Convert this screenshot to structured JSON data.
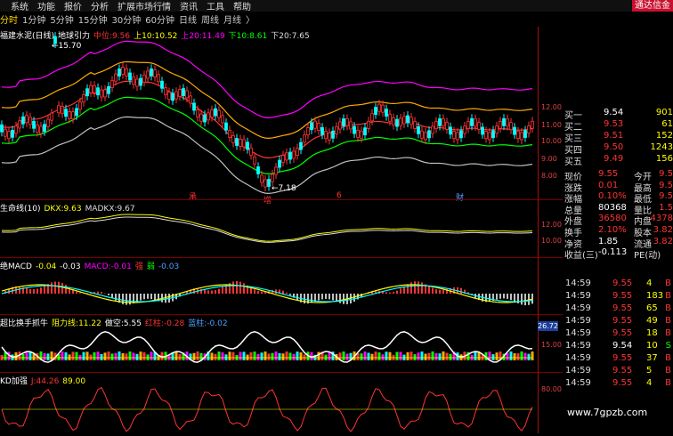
{
  "menu": {
    "items": [
      "系统",
      "功能",
      "报价",
      "分析",
      "扩展市场行情",
      "资讯",
      "工具",
      "帮助"
    ],
    "brand": "通达信金"
  },
  "periods": {
    "items": [
      "分时",
      "1分钟",
      "5分钟",
      "15分钟",
      "30分钟",
      "60分钟",
      "日线",
      "周线",
      "月线"
    ],
    "more": "〉"
  },
  "main_panel": {
    "stock": "福建水泥(日线)",
    "indicator": "地球引力",
    "mid_label": "中位:",
    "mid_value": "9.56",
    "up10_label": "上10:",
    "up10_value": "10.52",
    "up20_label": "上20:",
    "up20_value": "11.49",
    "down10_label": "下10:",
    "down10_value": "8.61",
    "down20_label": "下20:",
    "down20_value": "7.65",
    "high_mark": "15.70",
    "low_mark": "7.18",
    "event_markers": [
      "承",
      "增",
      "6",
      "财"
    ]
  },
  "panel2": {
    "name": "生命线(10)",
    "dkx_label": "DKX:",
    "dkx_value": "9.63",
    "madkx_label": "MADKX:",
    "madkx_value": "9.67"
  },
  "panel3": {
    "name": "绝MACD",
    "v1": "-0.04",
    "v2": "-0.03",
    "macd_label": "MACD:",
    "macd_value": "-0.01",
    "tag1": "强",
    "tag2": "弱",
    "v3": "-0.03"
  },
  "panel4": {
    "name": "超比换手抓牛",
    "force_label": "阻力线:",
    "force_value": "11.22",
    "short_label": "做空:",
    "short_value": "5.55",
    "red_label": "红柱:",
    "red_value": "-0.28",
    "blue_label": "蓝柱:",
    "blue_value": "-0.02",
    "box_value": "26.72"
  },
  "panel5": {
    "name": "KD加强",
    "j_label": "J:",
    "j_value": "44.26",
    "v2": "89.00"
  },
  "axis_ticks": {
    "main": [
      "12.00",
      "11.00",
      "10.00",
      "9.00",
      "8.00"
    ],
    "p2": [
      "12.00",
      "10.00"
    ],
    "p4": [
      "15.00"
    ],
    "p5": [
      "80.00"
    ]
  },
  "quote": {
    "buy_rows": [
      {
        "label": "买一",
        "price": "9.54",
        "vol": "901"
      },
      {
        "label": "买二",
        "price": "9.53",
        "vol": "61"
      },
      {
        "label": "买三",
        "price": "9.51",
        "vol": "152"
      },
      {
        "label": "买四",
        "price": "9.50",
        "vol": "1243"
      },
      {
        "label": "买五",
        "price": "9.49",
        "vol": "156"
      }
    ],
    "stats": [
      {
        "l1": "现价",
        "v1": "9.55",
        "l2": "今开",
        "v2": "9.5"
      },
      {
        "l1": "涨跌",
        "v1": "0.01",
        "l2": "最高",
        "v2": "9.5"
      },
      {
        "l1": "涨幅",
        "v1": "0.10%",
        "l2": "最低",
        "v2": "9.5"
      },
      {
        "l1": "总量",
        "v1": "80368",
        "l2": "量比",
        "v2": "1.5"
      },
      {
        "l1": "外盘",
        "v1": "36580",
        "l2": "内盘",
        "v2": "4378"
      },
      {
        "l1": "换手",
        "v1": "2.10%",
        "l2": "股本",
        "v2": "3.82"
      },
      {
        "l1": "净资",
        "v1": "1.85",
        "l2": "流通",
        "v2": "3.82"
      },
      {
        "l1": "收益(三)",
        "v1": "-0.113",
        "l2": "PE(动)",
        "v2": ""
      }
    ]
  },
  "trades": [
    {
      "t": "14:59",
      "p": "9.55",
      "v": "4",
      "s": "B"
    },
    {
      "t": "14:59",
      "p": "9.55",
      "v": "183",
      "s": "B"
    },
    {
      "t": "14:59",
      "p": "9.55",
      "v": "65",
      "s": "B"
    },
    {
      "t": "14:59",
      "p": "9.55",
      "v": "49",
      "s": "B"
    },
    {
      "t": "14:59",
      "p": "9.55",
      "v": "18",
      "s": "B"
    },
    {
      "t": "14:59",
      "p": "9.54",
      "v": "10",
      "s": "S"
    },
    {
      "t": "14:59",
      "p": "9.55",
      "v": "37",
      "s": "B"
    },
    {
      "t": "14:59",
      "p": "9.55",
      "v": "5",
      "s": "B"
    },
    {
      "t": "14:59",
      "p": "9.55",
      "v": "4",
      "s": "B"
    }
  ],
  "watermark": "www.7gpzb.com",
  "colors": {
    "up": "#ff3333",
    "down": "#00ffff",
    "yellow": "#ffff00",
    "white": "#ffffff",
    "magenta": "#ff00ff",
    "orange": "#ffaa00",
    "green": "#00ff00",
    "gray": "#c0c0c0"
  }
}
